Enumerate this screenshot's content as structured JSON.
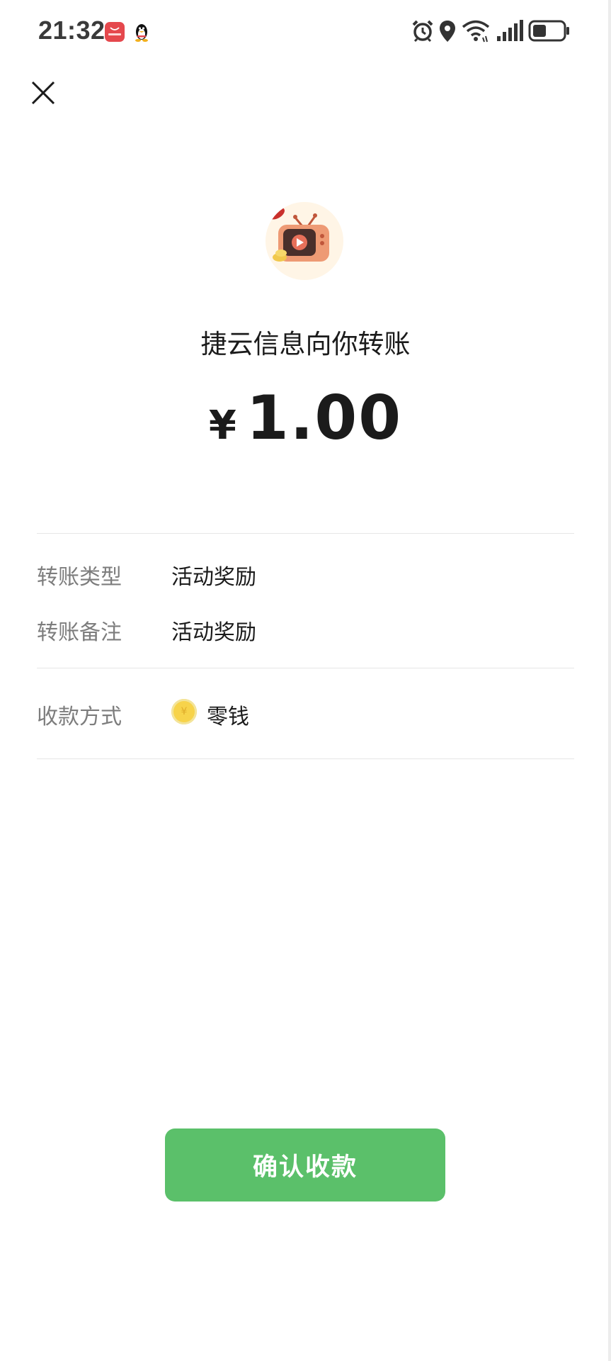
{
  "status_bar": {
    "time": "21:32",
    "icons": [
      "app-store-icon",
      "qq-penguin-icon",
      "alarm-icon",
      "location-icon",
      "wifi-icon",
      "signal-icon",
      "battery-icon"
    ]
  },
  "header": {
    "close_icon": "close-icon"
  },
  "transfer": {
    "payer_line": "捷云信息向你转账",
    "currency": "¥",
    "amount": "1.00"
  },
  "details": {
    "type_label": "转账类型",
    "type_value": "活动奖励",
    "note_label": "转账备注",
    "note_value": "活动奖励",
    "method_label": "收款方式",
    "method_value": "零钱",
    "method_icon": "coin-icon",
    "coin_symbol": "¥"
  },
  "actions": {
    "confirm_label": "确认收款"
  },
  "colors": {
    "primary_green": "#5bc06a",
    "text_primary": "#1b1b1b",
    "text_secondary": "#7d7d7d",
    "coin_yellow": "#f7d34a"
  }
}
